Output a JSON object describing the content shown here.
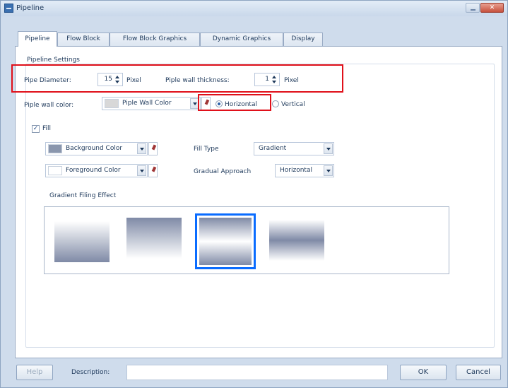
{
  "window": {
    "title": "Pipeline",
    "close_label": "✕"
  },
  "tabs": [
    {
      "label": "Pipeline"
    },
    {
      "label": "Flow Block"
    },
    {
      "label": "Flow Block Graphics"
    },
    {
      "label": "Dynamic Graphics"
    },
    {
      "label": "Display"
    }
  ],
  "settings": {
    "group_label": "Pipeline Settings",
    "diameter_label": "Pipe Diameter:",
    "diameter_value": "15",
    "diameter_unit": "Pixel",
    "thickness_label": "Piple wall thickness:",
    "thickness_value": "1",
    "thickness_unit": "Pixel",
    "wall_color_label": "Piple wall color:",
    "wall_color_value": "Piple Wall Color",
    "wall_color_swatch": "#d8d8d8",
    "orientation_horizontal": "Horizontal",
    "orientation_vertical": "Vertical",
    "orientation_selected": "Horizontal"
  },
  "fill": {
    "checkbox_label": "Fill",
    "checked": true,
    "background_label": "Background Color",
    "background_swatch": "#8a96ad",
    "foreground_label": "Foreground Color",
    "foreground_swatch": "#ffffff",
    "fill_type_label": "Fill Type",
    "fill_type_value": "Gradient",
    "approach_label": "Gradual Approach",
    "approach_value": "Horizontal",
    "effect_label": "Gradient Filing Effect",
    "selected_effect": 3
  },
  "footer": {
    "help_label": "Help",
    "description_label": "Description:",
    "description_value": "",
    "ok_label": "OK",
    "cancel_label": "Cancel"
  },
  "colors": {
    "highlight": "#e0101a",
    "selection": "#0a6cff"
  }
}
